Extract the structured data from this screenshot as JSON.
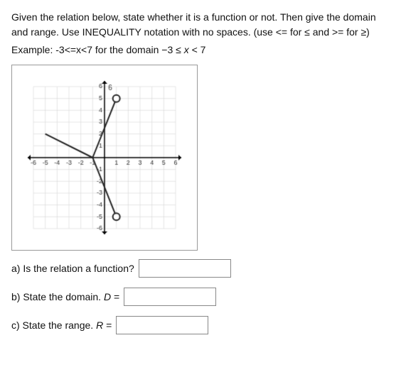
{
  "instructions": {
    "line1": "Given the relation below, state whether it is a function or not.  Then give the domain and range.  Use INEQUALITY notation with no spaces. (use  <= for ≤ and >= for ≥)",
    "example_label": "Example:",
    "example_text": "-3<=x<7  for the domain −3 ≤ x < 7"
  },
  "questions": {
    "a_label": "a) Is the relation a function?",
    "b_label": "b) State the domain.",
    "b_var": "D",
    "c_label": "c) State the range.",
    "c_var": "R"
  },
  "graph": {
    "x_min": -6,
    "x_max": 6,
    "y_min": -6,
    "y_max": 6
  }
}
